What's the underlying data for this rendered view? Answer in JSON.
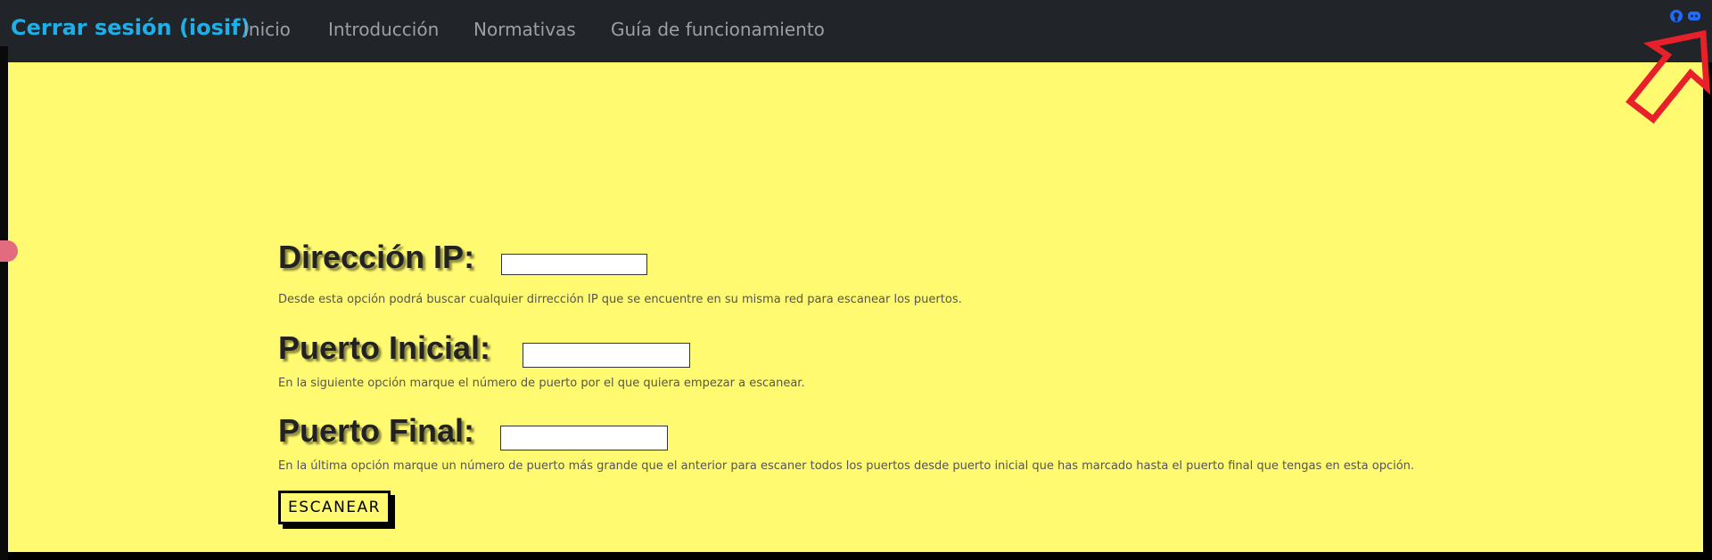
{
  "navbar": {
    "brand": "Cerrar sesión (iosif)",
    "links": [
      "Inicio",
      "Introducción",
      "Normativas",
      "Guía de funcionamiento"
    ],
    "social_icons": [
      "github-icon",
      "discord-icon"
    ]
  },
  "form": {
    "ip": {
      "label": "Dirección IP:",
      "description": "Desde esta opción podrá buscar cualquier dirrección IP que se encuentre en su misma red para escanear los puertos."
    },
    "start_port": {
      "label": "Puerto Inicial:",
      "description": "En la siguiente opción marque el número de puerto por el que quiera empezar a escanear."
    },
    "end_port": {
      "label": "Puerto Final:",
      "description": "En la última opción marque un número de puerto más grande que el anterior para escaner todos los puertos desde puerto inicial que has marcado hasta el puerto final que tengas en esta opción."
    },
    "scan_button": "ESCANEAR"
  },
  "colors": {
    "navbar_bg": "#212529",
    "brand": "#1eaee8",
    "content_bg": "#fffa70",
    "annotation_arrow": "#e8202a"
  }
}
